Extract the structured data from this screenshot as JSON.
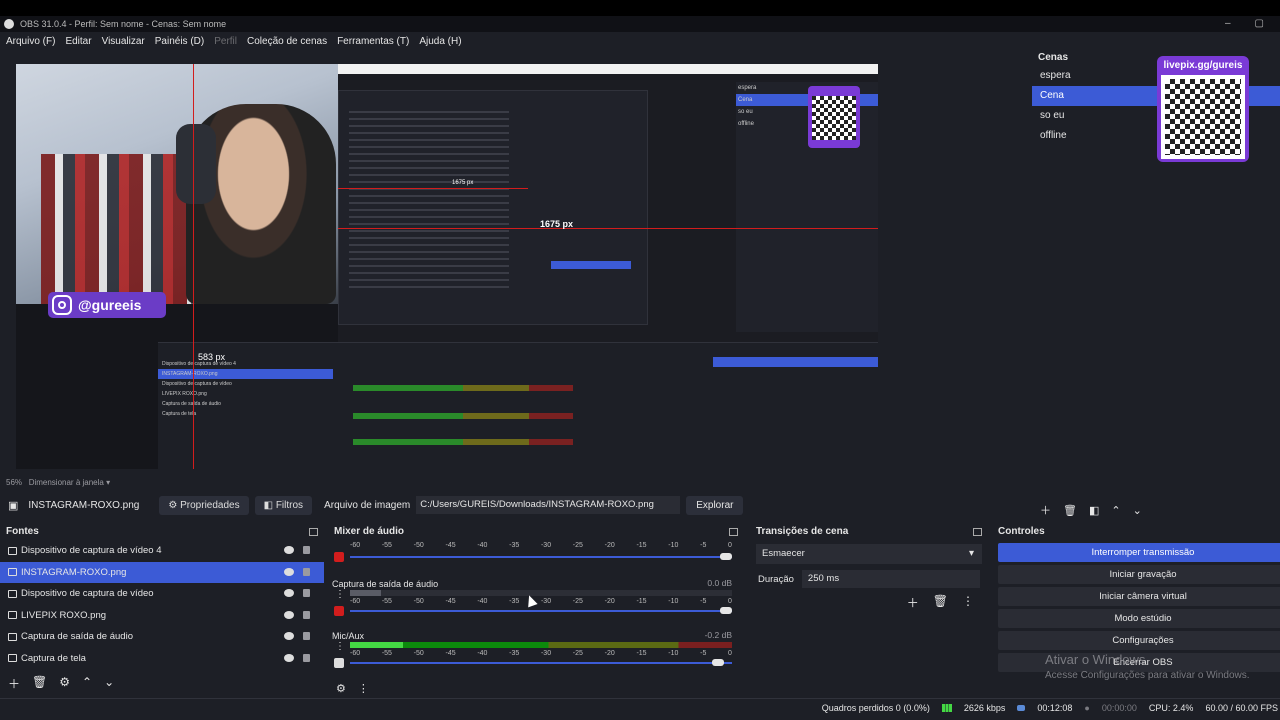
{
  "window": {
    "title": "OBS 31.0.4 - Perfil: Sem nome - Cenas: Sem nome"
  },
  "menu": [
    "Arquivo (F)",
    "Editar",
    "Visualizar",
    "Painéis (D)",
    "Perfil",
    "Coleção de cenas",
    "Ferramentas (T)",
    "Ajuda (H)"
  ],
  "preview": {
    "instagram_handle": "@gureeis",
    "qr_text": "livepix.gg/gureis",
    "measure_horizontal": "1675 px",
    "measure_small": "1675 px",
    "measure_vertical": "583 px",
    "zoom_status": "56%",
    "scale_mode": "Dimensionar à janela"
  },
  "scenes": {
    "header": "Cenas",
    "items": [
      "espera",
      "Cena",
      "so eu",
      "offline"
    ],
    "selected": "Cena"
  },
  "source_toolbar": {
    "source_name": "INSTAGRAM-ROXO.png",
    "properties": "Propriedades",
    "filters": "Filtros",
    "image_file_label": "Arquivo de imagem",
    "path": "C:/Users/GUREIS/Downloads/INSTAGRAM-ROXO.png",
    "explore": "Explorar"
  },
  "sources": {
    "header": "Fontes",
    "items": [
      "Dispositivo de captura de vídeo 4",
      "INSTAGRAM-ROXO.png",
      "Dispositivo de captura de vídeo",
      "LIVEPIX ROXO.png",
      "Captura de saída de áudio",
      "Captura de tela"
    ]
  },
  "mixer": {
    "header": "Mixer de áudio",
    "ticks": [
      "-60",
      "-55",
      "-50",
      "-45",
      "-40",
      "-35",
      "-30",
      "-25",
      "-20",
      "-15",
      "-10",
      "-5",
      "0"
    ],
    "channels": [
      {
        "name": "",
        "db": ""
      },
      {
        "name": "Captura de saída de áudio",
        "db": "0.0 dB"
      },
      {
        "name": "Mic/Aux",
        "db": "-0.2 dB"
      }
    ]
  },
  "transitions": {
    "header": "Transições de cena",
    "selected": "Esmaecer",
    "duration_label": "Duração",
    "duration_value": "250 ms"
  },
  "controls": {
    "header": "Controles",
    "buttons": [
      "Interromper transmissão",
      "Iniciar gravação",
      "Iniciar câmera virtual",
      "Modo estúdio",
      "Configurações",
      "Encerrar OBS"
    ]
  },
  "watermark": {
    "title": "Ativar o Windows",
    "subtitle": "Acesse Configurações para ativar o Windows."
  },
  "status": {
    "dropped_frames": "Quadros perdidos 0 (0.0%)",
    "bitrate": "2626 kbps",
    "stream_time": "00:12:08",
    "record_time": "00:00:00",
    "cpu": "CPU: 2.4%",
    "fps": "60.00 / 60.00 FPS"
  },
  "colors": {
    "accent": "#3c5bd6",
    "panel": "#1d1f26",
    "qr_purple": "#7a3ad6",
    "guide_red": "#d21d1d"
  }
}
